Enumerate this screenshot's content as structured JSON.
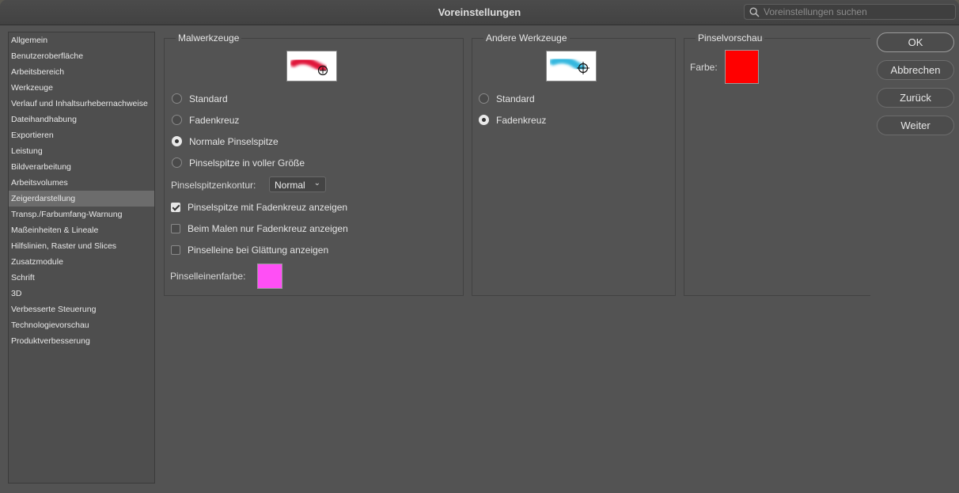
{
  "window": {
    "title": "Voreinstellungen"
  },
  "search": {
    "placeholder": "Voreinstellungen suchen"
  },
  "sidebar": {
    "items": [
      {
        "label": "Allgemein"
      },
      {
        "label": "Benutzeroberfläche"
      },
      {
        "label": "Arbeitsbereich"
      },
      {
        "label": "Werkzeuge"
      },
      {
        "label": "Verlauf und Inhaltsurhebernachweise"
      },
      {
        "label": "Dateihandhabung"
      },
      {
        "label": "Exportieren"
      },
      {
        "label": "Leistung"
      },
      {
        "label": "Bildverarbeitung"
      },
      {
        "label": "Arbeitsvolumes"
      },
      {
        "label": "Zeigerdarstellung",
        "selected": true
      },
      {
        "label": "Transp./Farbumfang-Warnung"
      },
      {
        "label": "Maßeinheiten & Lineale"
      },
      {
        "label": "Hilfslinien, Raster und Slices"
      },
      {
        "label": "Zusatzmodule"
      },
      {
        "label": "Schrift"
      },
      {
        "label": "3D"
      },
      {
        "label": "Verbesserte Steuerung"
      },
      {
        "label": "Technologievorschau"
      },
      {
        "label": "Produktverbesserung"
      }
    ]
  },
  "painting_tools": {
    "title": "Malwerkzeuge",
    "options": [
      {
        "label": "Standard",
        "selected": false
      },
      {
        "label": "Fadenkreuz",
        "selected": false
      },
      {
        "label": "Normale Pinselspitze",
        "selected": true
      },
      {
        "label": "Pinselspitze in voller Größe",
        "selected": false
      }
    ],
    "outline_label": "Pinselspitzenkontur:",
    "outline_value": "Normal",
    "checkboxes": [
      {
        "label": "Pinselspitze mit Fadenkreuz anzeigen",
        "checked": true
      },
      {
        "label": "Beim Malen nur Fadenkreuz anzeigen",
        "checked": false
      },
      {
        "label": "Pinselleine bei Glättung anzeigen",
        "checked": false
      }
    ],
    "leash_color_label": "Pinselleinenfarbe:",
    "leash_color": "#ff4ff5",
    "preview_stroke_color": "#e0143a"
  },
  "other_tools": {
    "title": "Andere Werkzeuge",
    "options": [
      {
        "label": "Standard",
        "selected": false
      },
      {
        "label": "Fadenkreuz",
        "selected": true
      }
    ],
    "preview_stroke_color": "#35b8df"
  },
  "brush_preview": {
    "title": "Pinselvorschau",
    "color_label": "Farbe:",
    "color": "#ff0000"
  },
  "buttons": {
    "ok": "OK",
    "cancel": "Abbrechen",
    "prev": "Zurück",
    "next": "Weiter"
  }
}
